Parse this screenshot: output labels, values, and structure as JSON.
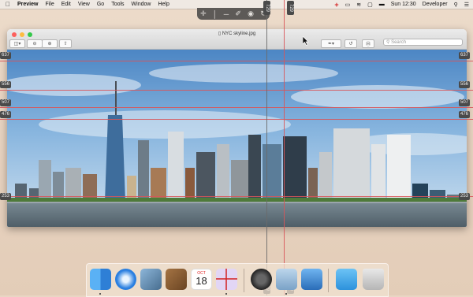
{
  "menubar": {
    "app_name": "Preview",
    "menus": [
      "File",
      "Edit",
      "View",
      "Go",
      "Tools",
      "Window",
      "Help"
    ],
    "clock": "Sun 12:30",
    "user": "Developer"
  },
  "window": {
    "title": "NYC skyline.jpg",
    "search_placeholder": "Search"
  },
  "guides": {
    "horizontal_labels": [
      "637",
      "556",
      "507",
      "476",
      "253"
    ],
    "vertical_labels": [
      "729",
      "729"
    ]
  },
  "dock": {
    "calendar_month": "OCT",
    "calendar_day": "18"
  },
  "colors": {
    "guide": "#d8555a",
    "accent": "#d32020"
  }
}
